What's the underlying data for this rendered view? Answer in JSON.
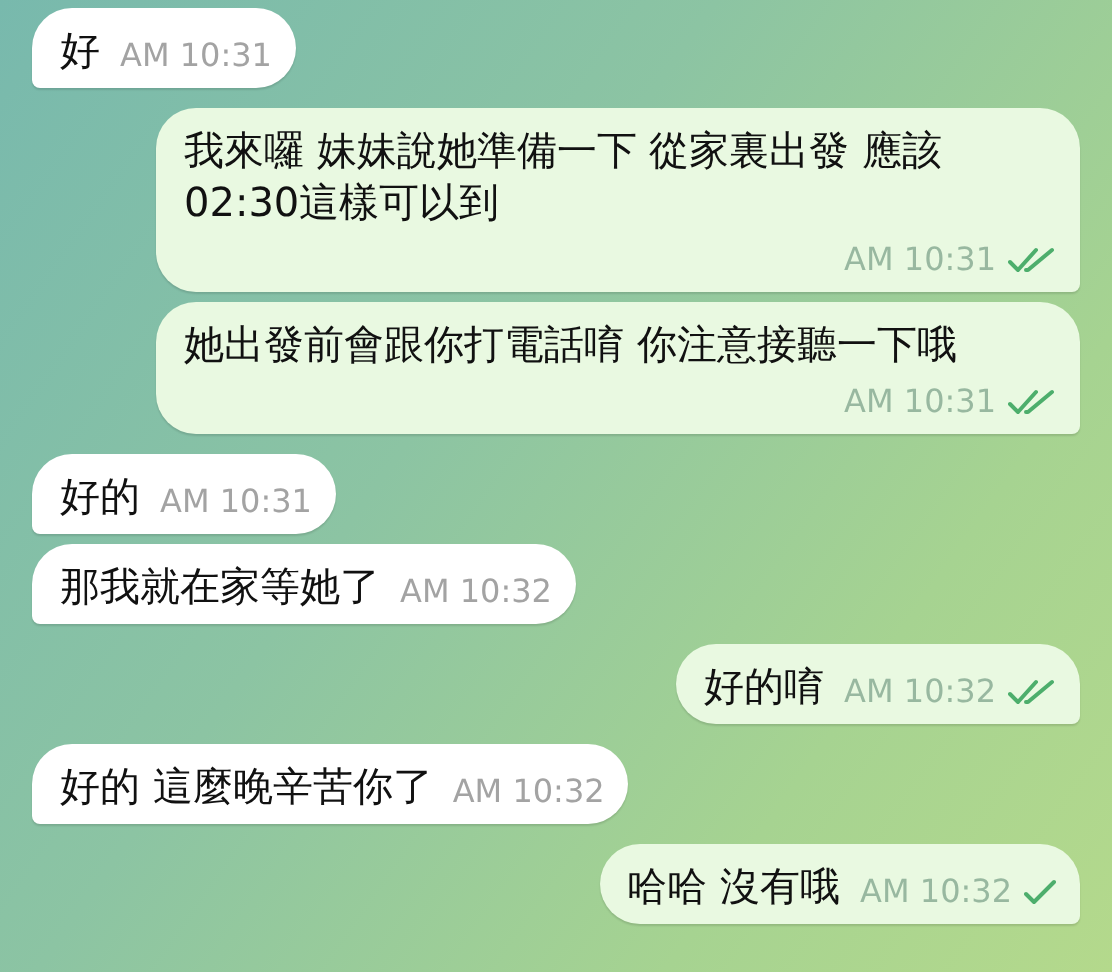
{
  "messages": [
    {
      "kind": "incoming",
      "text": "好",
      "time": "AM 10:31"
    },
    {
      "kind": "outgoing",
      "text": "我來囉 妹妹說她準備一下 從家裏出發 應該02:30這樣可以到",
      "time": "AM 10:31",
      "read": true
    },
    {
      "kind": "outgoing",
      "text": "她出發前會跟你打電話唷 你注意接聽一下哦",
      "time": "AM 10:31",
      "read": true
    },
    {
      "kind": "incoming",
      "text": "好的",
      "time": "AM 10:31"
    },
    {
      "kind": "incoming",
      "text": "那我就在家等她了",
      "time": "AM 10:32"
    },
    {
      "kind": "outgoing",
      "text": "好的唷",
      "time": "AM 10:32",
      "read": true
    },
    {
      "kind": "incoming",
      "text": "好的 這麼晚辛苦你了",
      "time": "AM 10:32"
    },
    {
      "kind": "outgoing",
      "text": "哈哈 沒有哦",
      "time": "AM 10:32",
      "read": false
    }
  ]
}
